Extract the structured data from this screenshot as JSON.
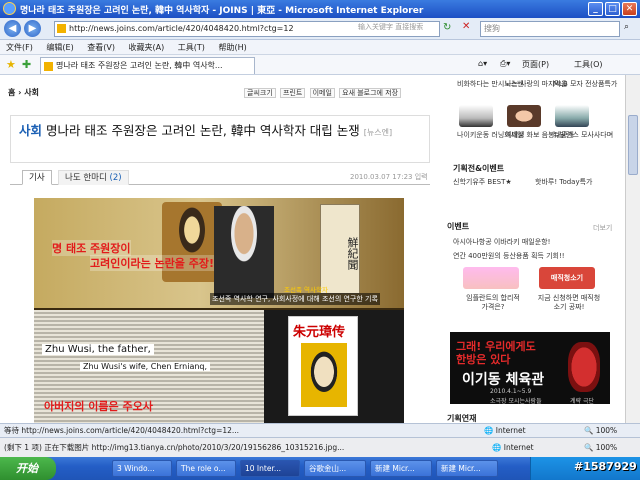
{
  "window": {
    "title": "명나라 태조 주원장은 고려인 논란, 韓中 역사학자 - JOINS | 東亞 - Microsoft Internet Explorer"
  },
  "toolbar": {
    "url": "http://news.joins.com/article/420/4048420.html?ctg=12",
    "search_hint": "输入关键字 直接搜索",
    "search_placeholder": "搜狗"
  },
  "menu": {
    "items": [
      "文件(F)",
      "编辑(E)",
      "查看(V)",
      "收藏夹(A)",
      "工具(T)",
      "帮助(H)"
    ]
  },
  "tab": {
    "label": "명나라 태조 주원장은 고려인 논란, 韓中 역사학..."
  },
  "commandbar": {
    "page": "页面(P)",
    "tools": "工具(O)"
  },
  "article": {
    "breadcrumb": "홈 › 사회",
    "tools": [
      "글씨크기",
      "프린트",
      "이메일",
      "요새 블로그에 저장"
    ],
    "section": "사회",
    "headline": "명나라 태조 주원장은 고려인 논란, 韓中 역사학자 대립 논쟁",
    "source": "[뉴스엔]",
    "tab_article": "기사",
    "tab_opinion": "나도 한마디",
    "opinion_count": "(2)",
    "date": "2010.03.07 17:23 입력"
  },
  "photo": {
    "red_line1": "명 태조 주원장이",
    "red_line2": "고려인이라는 논란을 주장!",
    "caption_main": "조선족 역사학 연구, 사회사정에 대해 조선의 연구한 기록",
    "caption_top": "조선족 역사학자",
    "caption_bottom": "주원장",
    "scroll_text": "鮮紀聞",
    "highlight1": "Zhu Wusi, the father,",
    "highlight2": "Zhu Wusi's wife, Chen Ernianq,",
    "red_line3": "아버지의 이름은 주오사",
    "book_title": "朱元璋传"
  },
  "sidebar": {
    "items_top": [
      "비화하다는 만시노스벤",
      "나는 사랑의 마지막을",
      "MLB 모자 전상품특가"
    ],
    "items_mid": [
      "나이키운동 러닝화세일",
      "여대생 화보 음봉대공개",
      "뉴발란스 모사사다며"
    ],
    "section_title": "기획전&이벤트",
    "section_items": [
      "신학기유주 BEST★",
      "핫바루! Today특가"
    ],
    "event_title": "이벤트",
    "more": "더보기",
    "event_items": [
      "아시아나항공 이바라키 매일운항!",
      "연간 400만원의 등산용품 획득 기회!!"
    ],
    "event_caption1": "임플란트의 합리적 가격은?",
    "event_caption2": "지금 신청하면 매직청소기 공짜!",
    "event_badge": "매직청소기",
    "ad_line1": "그래! 우리에게도",
    "ad_line2": "한방은 있다",
    "ad_title": "이기동 체육관",
    "ad_date": "2010.4.1~5.9",
    "ad_sub": "소극장 모시는사람들",
    "ad_more": "계략 극단",
    "bottom_title": "기획연재"
  },
  "status": {
    "text": "等待 http://news.joins.com/article/420/4048420.html?ctg=12...",
    "zone": "Internet",
    "zoom": "100%"
  },
  "status2": {
    "text": "(剩下 1 项) 正在下载图片 http://img13.tianya.cn/photo/2010/3/20/19156286_10315216.jpg...",
    "zone": "Internet",
    "zoom": "100%"
  },
  "taskbar": {
    "start": "开始",
    "items": [
      "3 Windo...",
      "The role o...",
      "10 Inter...",
      "谷歌金山...",
      "新建 Micr...",
      "新建 Micr..."
    ],
    "watermark": "#1587929"
  }
}
